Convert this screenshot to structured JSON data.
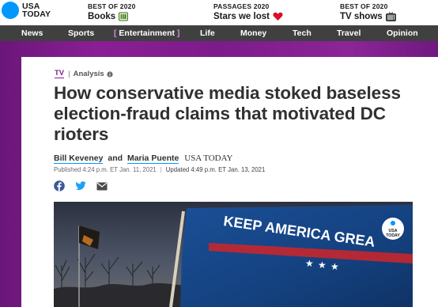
{
  "site": {
    "logo_line1": "USA",
    "logo_line2": "TODAY"
  },
  "promos": [
    {
      "kicker": "BEST OF 2020",
      "title": "Books",
      "icon": "books-emoji"
    },
    {
      "kicker": "PASSAGES 2020",
      "title": "Stars we lost",
      "icon": "heart-emoji"
    },
    {
      "kicker": "BEST OF 2020",
      "title": "TV shows",
      "icon": "tv-emoji"
    }
  ],
  "nav": {
    "items": [
      "News",
      "Sports",
      "Entertainment",
      "Life",
      "Money",
      "Tech",
      "Travel",
      "Opinion"
    ],
    "active": "Entertainment"
  },
  "article": {
    "section": "TV",
    "label": "Analysis",
    "headline": "How conservative media stoked baseless election-fraud claims that motivated DC rioters",
    "authors": [
      "Bill Keveney",
      "Maria Puente"
    ],
    "author_joiner": "and",
    "outlet": "USA TODAY",
    "published": "Published 4:24 p.m. ET Jan. 11, 2021",
    "updated": "Updated 4:49 p.m. ET Jan. 13, 2021"
  },
  "hero": {
    "flag_text": "KEEP AMERICA GREA",
    "badge_line1": "USA",
    "badge_line2": "TODAY"
  },
  "colors": {
    "brand_blue": "#0098fe",
    "section_purple": "#7f2191",
    "nav_bg": "#404040",
    "facebook": "#3b5998",
    "twitter": "#1da1f2"
  }
}
